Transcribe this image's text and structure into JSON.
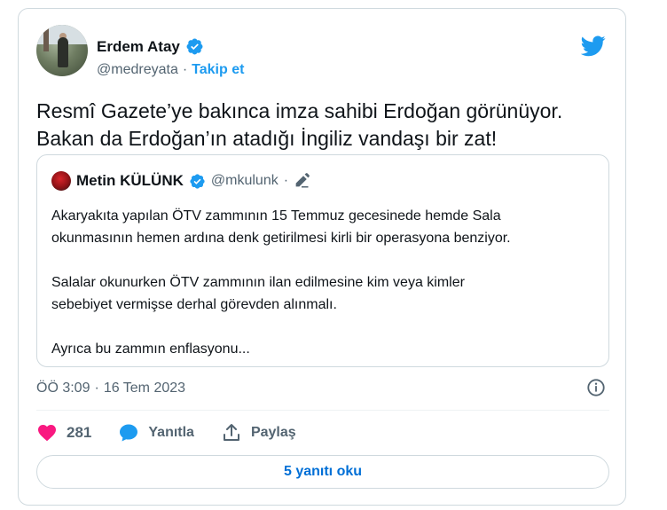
{
  "author": {
    "name": "Erdem Atay",
    "handle": "@medreyata",
    "separator": "·",
    "follow_label": "Takip et"
  },
  "tweet": {
    "lines": [
      "Resmî Gazete’ye bakınca imza sahibi Erdoğan görünüyor.",
      "Bakan da Erdoğan’ın atadığı İngiliz vandaşı bir zat!"
    ]
  },
  "quote": {
    "name": "Metin KÜLÜNK",
    "handle": "@mkulunk",
    "separator": "·",
    "paragraphs": [
      [
        "Akaryakıta yapılan ÖTV zammının 15 Temmuz gecesinede hemde Sala",
        "okunmasının hemen ardına denk getirilmesi kirli bir operasyona benziyor."
      ],
      [
        "Salalar okunurken ÖTV zammının ilan edilmesine kim veya kimler",
        "sebebiyet vermişse derhal görevden alınmalı."
      ],
      [
        "Ayrıca bu zammın enflasyonu..."
      ]
    ]
  },
  "meta": {
    "time": "ÖÖ 3:09",
    "separator": "·",
    "date": "16 Tem 2023"
  },
  "actions": {
    "like_count": "281",
    "reply_label": "Yanıtla",
    "share_label": "Paylaş"
  },
  "replies_button": "5 yanıtı oku",
  "icons": {
    "verified": "verified-badge-icon",
    "brand": "twitter-bird-icon",
    "like": "heart-icon",
    "reply": "speech-bubble-icon",
    "share": "share-upload-icon",
    "info": "info-icon",
    "edit": "pencil-edit-icon"
  },
  "colors": {
    "accent": "#1d9bf0",
    "like": "#f91880",
    "link": "#006fd6",
    "secondary_text": "#536471",
    "border": "#cfd9de"
  }
}
